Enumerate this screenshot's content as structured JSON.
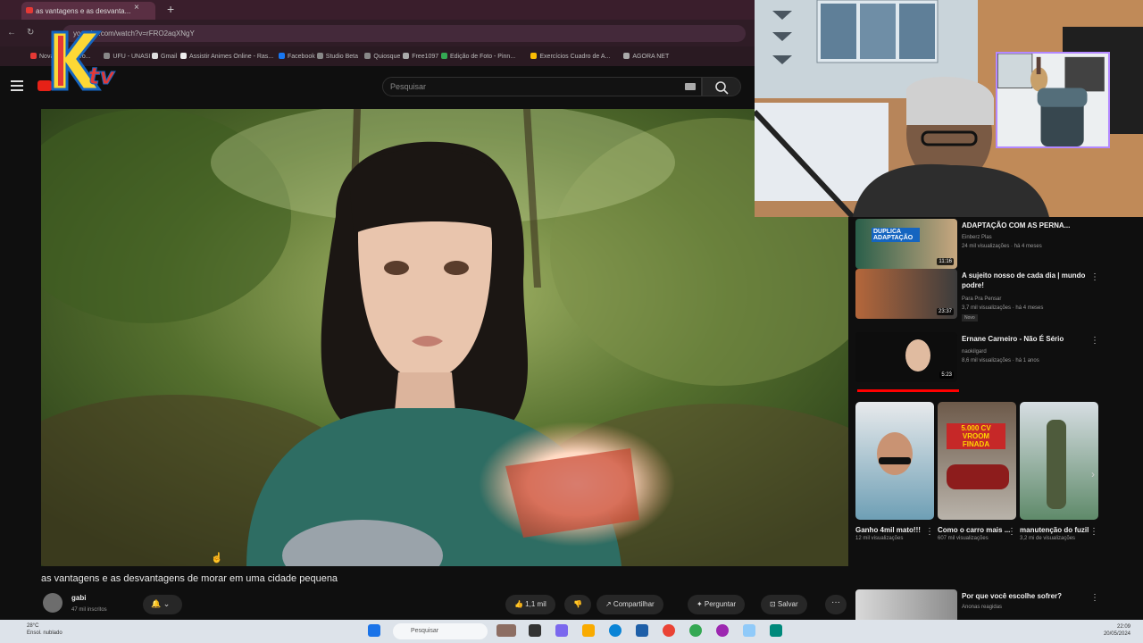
{
  "browser": {
    "tab_title": "as vantagens e as desvanta...",
    "new_tab": "+",
    "url": "youtube.com/watch?v=rFRO2aqXNgY",
    "bookmarks": [
      {
        "label": "Nova Letras - Yo...",
        "color": "#e53935"
      },
      {
        "label": "UFU - UNASI",
        "color": "#888888"
      },
      {
        "label": "Gmail",
        "color": "#dddddd"
      },
      {
        "label": "Assistir Animes Online - Ras...",
        "color": "#eeeeee"
      },
      {
        "label": "Facebook",
        "color": "#1877f2"
      },
      {
        "label": "Studio Beta",
        "color": "#888888"
      },
      {
        "label": "Quiosque",
        "color": "#888888"
      },
      {
        "label": "Free1097",
        "color": "#aaaaaa"
      },
      {
        "label": "Edição de Foto - Pinn...",
        "color": "#34a853"
      },
      {
        "label": "Exercícios Cuadro de A...",
        "color": "#fbbc04"
      },
      {
        "label": "AGORA NET",
        "color": "#aaaaaa"
      }
    ]
  },
  "overlay": {
    "logo_text": "KTV"
  },
  "youtube": {
    "search_placeholder": "Pesquisar",
    "video_title": "as vantagens e as desvantagens de morar em uma cidade pequena",
    "channel_name": "gabi",
    "channel_subs": "47 mil inscritos",
    "bell_label": "🔔 ⌄",
    "like_label": "👍 1,1 mil",
    "dislike_label": "👎",
    "share_label": "↗ Compartilhar",
    "thanks_label": "✦ Perguntar",
    "save_label": "⊡ Salvar",
    "more_label": "···"
  },
  "sidebar": {
    "recs": [
      {
        "title": "ADAPTAÇÃO COM AS PERNA...",
        "channel": "Einberz Plas",
        "meta": "24 mil visualizações · há 4 meses",
        "duration": "11:16",
        "thumb_text": "DUPLICA ADAPTAÇÃO"
      },
      {
        "title": "A sujeito nosso de cada dia | mundo podre!",
        "channel": "Para Pra Pensar",
        "meta": "3,7 mil visualizações · há 4 meses",
        "duration": "23:37",
        "badge": "Novo"
      },
      {
        "title": "Ernane Carneiro - Não É Sério",
        "channel": "naokilgard",
        "meta": "8,6 mil visualizações · há 1 anos",
        "duration": "5:23"
      },
      {
        "title": "Por que você escolhe sofrer?",
        "channel": "Anonas reagidas",
        "meta": ""
      }
    ],
    "shorts": [
      {
        "title": "Ganho 4mil mato!!!",
        "meta": "12 mil visualizações"
      },
      {
        "title": "Como o carro mais ...",
        "meta": "607 mil visualizações",
        "thumb_text": "5.000 CV VROOM FINADA"
      },
      {
        "title": "manutenção do fuzil",
        "meta": "3,2 mi de visualizações"
      }
    ]
  },
  "taskbar": {
    "weather_temp": "28°C",
    "weather_desc": "Ensol. nublado",
    "search_label": "Pesquisar",
    "clock_time": "22:09",
    "clock_date": "20/05/2024"
  }
}
